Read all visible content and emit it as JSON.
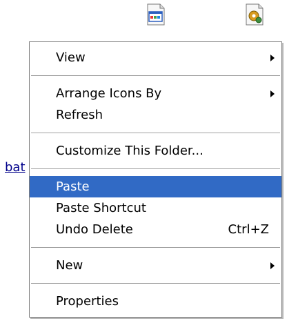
{
  "desktop": {
    "icons": [
      {
        "name": "application-window-icon"
      },
      {
        "name": "gear-document-icon"
      }
    ],
    "link_fragment": "bat"
  },
  "menu": {
    "view": "View",
    "arrange_icons_by": "Arrange Icons By",
    "refresh": "Refresh",
    "customize_folder": "Customize This Folder...",
    "paste": "Paste",
    "paste_shortcut": "Paste Shortcut",
    "undo_delete": "Undo Delete",
    "undo_delete_shortcut": "Ctrl+Z",
    "new": "New",
    "properties": "Properties"
  },
  "colors": {
    "selection": "#316ac5",
    "menu_background": "#ffffff",
    "separator": "#a0a0a0"
  }
}
